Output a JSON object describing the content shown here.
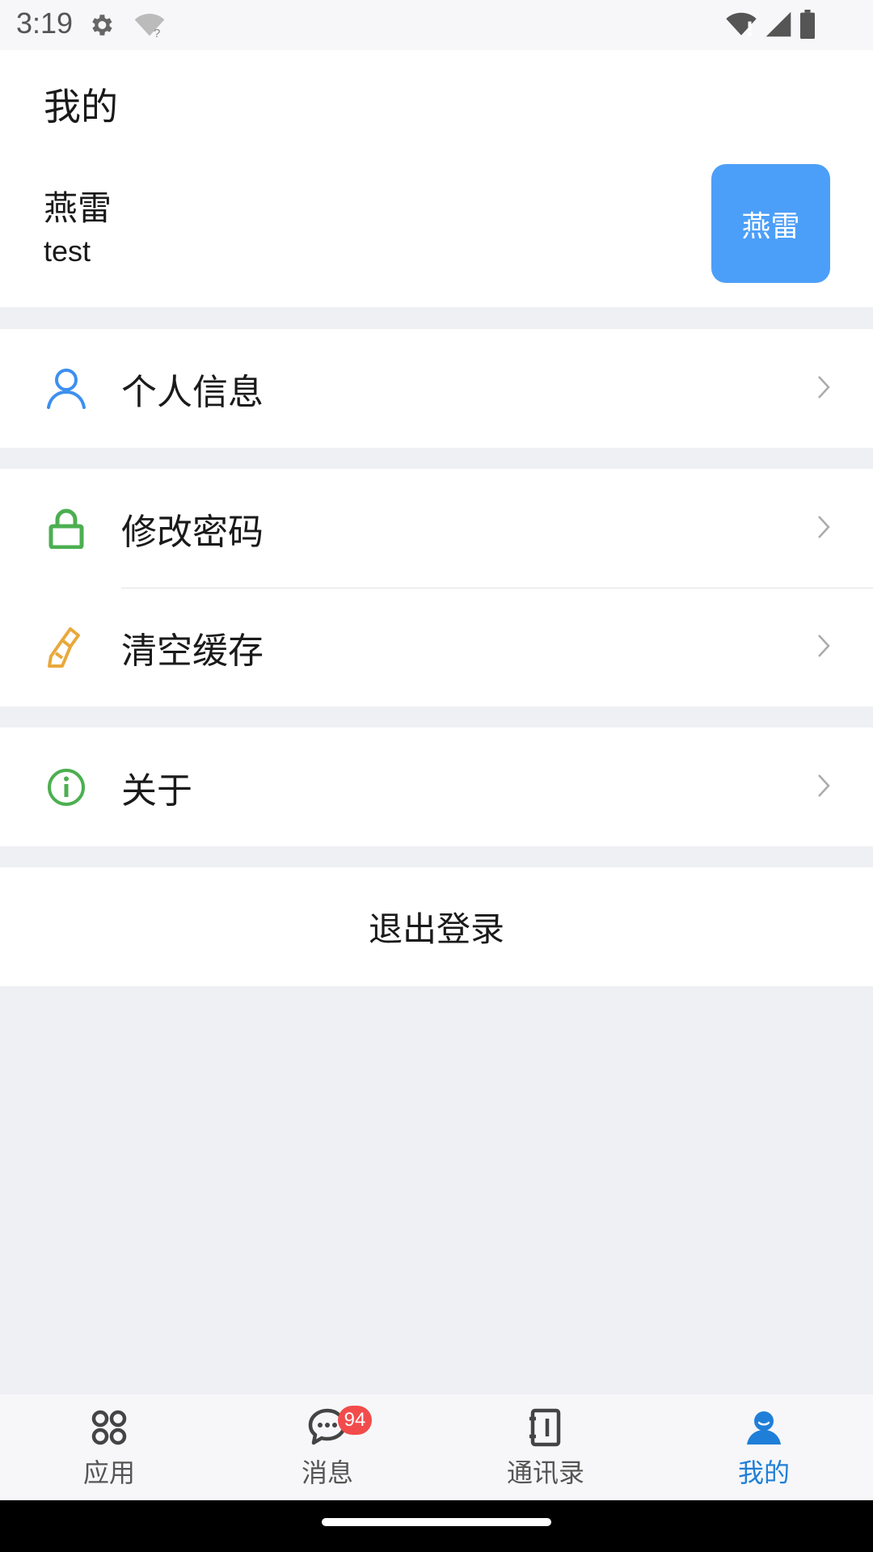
{
  "status_bar": {
    "time": "3:19"
  },
  "header": {
    "page_title": "我的",
    "user_name": "燕雷",
    "user_account": "test",
    "avatar_text": "燕雷"
  },
  "menu": {
    "personal_info": "个人信息",
    "change_password": "修改密码",
    "clear_cache": "清空缓存",
    "about": "关于"
  },
  "logout_label": "退出登录",
  "tabs": {
    "apps": "应用",
    "messages": "消息",
    "messages_badge": "94",
    "contacts": "通讯录",
    "mine": "我的"
  },
  "colors": {
    "accent": "#1f7fd8",
    "avatar_bg": "#4c9ff8",
    "badge": "#f24b4b",
    "lock_icon": "#4caf50",
    "brush_icon": "#e8a93c",
    "info_icon": "#4caf50"
  }
}
